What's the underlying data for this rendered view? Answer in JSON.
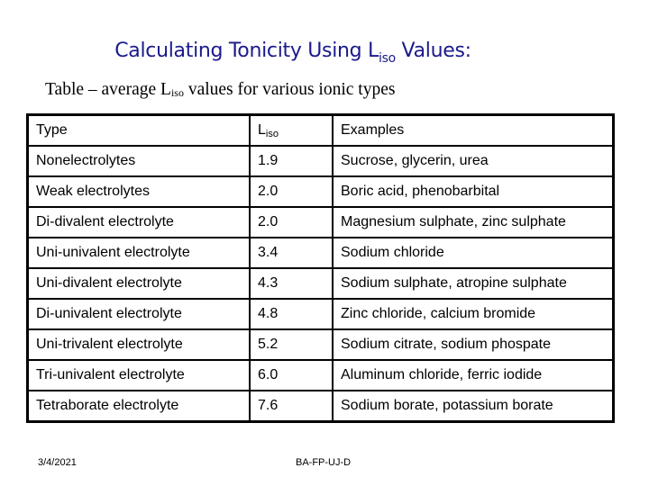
{
  "slide": {
    "title_prefix": "Calculating Tonicity Using L",
    "title_sub": "iso",
    "title_suffix": " Values:",
    "caption_prefix": "Table – average L",
    "caption_sub": "iso",
    "caption_suffix": " values for various ionic types"
  },
  "table": {
    "headers": {
      "type": "Type",
      "liso_main": "L",
      "liso_sub": "iso",
      "examples": "Examples"
    },
    "rows": [
      {
        "type": "Nonelectrolytes",
        "liso": "1.9",
        "examples": "Sucrose, glycerin, urea"
      },
      {
        "type": "Weak electrolytes",
        "liso": "2.0",
        "examples": "Boric acid, phenobarbital"
      },
      {
        "type": "Di-divalent electrolyte",
        "liso": "2.0",
        "examples": "Magnesium sulphate, zinc sulphate"
      },
      {
        "type": "Uni-univalent electrolyte",
        "liso": "3.4",
        "examples": "Sodium chloride"
      },
      {
        "type": "Uni-divalent electrolyte",
        "liso": "4.3",
        "examples": "Sodium sulphate, atropine sulphate"
      },
      {
        "type": "Di-univalent electrolyte",
        "liso": "4.8",
        "examples": "Zinc chloride, calcium bromide"
      },
      {
        "type": "Uni-trivalent electrolyte",
        "liso": "5.2",
        "examples": "Sodium  citrate, sodium phospate"
      },
      {
        "type": "Tri-univalent electrolyte",
        "liso": "6.0",
        "examples": "Aluminum chloride, ferric iodide"
      },
      {
        "type": "Tetraborate electrolyte",
        "liso": "7.6",
        "examples": "Sodium borate, potassium borate"
      }
    ]
  },
  "footer": {
    "date": "3/4/2021",
    "id": "BA-FP-UJ-D"
  },
  "colors": {
    "title": "#1a1a8c"
  }
}
